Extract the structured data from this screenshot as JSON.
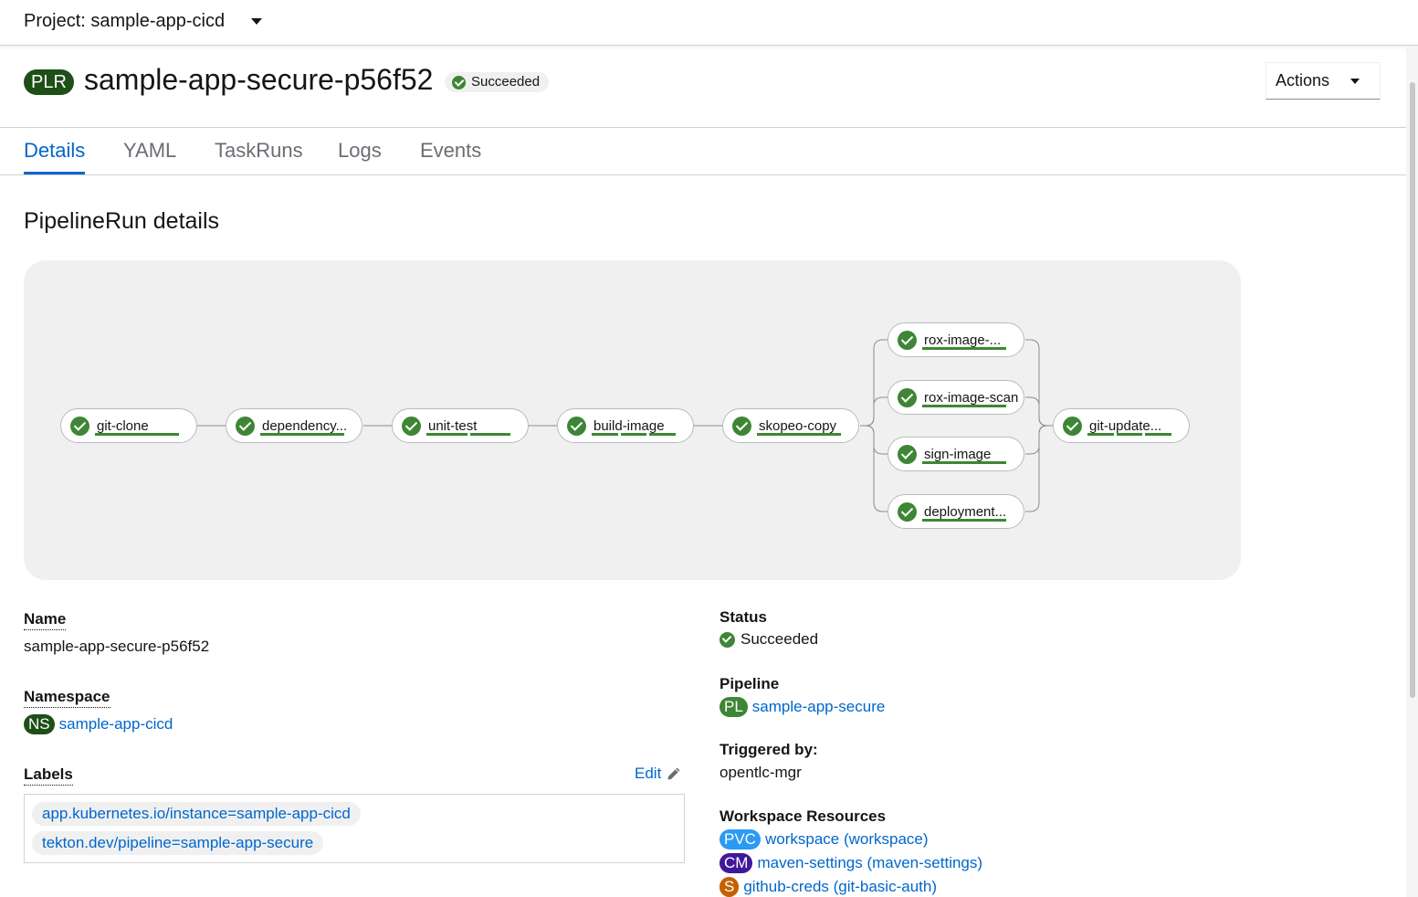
{
  "project_bar": {
    "label": "Project: sample-app-cicd"
  },
  "header": {
    "kind_badge": "PLR",
    "title": "sample-app-secure-p56f52",
    "status": "Succeeded",
    "actions_label": "Actions"
  },
  "tabs": [
    {
      "label": "Details"
    },
    {
      "label": "YAML"
    },
    {
      "label": "TaskRuns"
    },
    {
      "label": "Logs"
    },
    {
      "label": "Events"
    }
  ],
  "section_title": "PipelineRun details",
  "pipeline": {
    "tasks": [
      {
        "id": "git-clone",
        "label": "git-clone",
        "status": "Succeeded",
        "steps": 1
      },
      {
        "id": "dependency",
        "label": "dependency...",
        "status": "Succeeded",
        "steps": 1
      },
      {
        "id": "unit-test",
        "label": "unit-test",
        "status": "Succeeded",
        "steps": 2
      },
      {
        "id": "build-image",
        "label": "build-image",
        "status": "Succeeded",
        "steps": 3
      },
      {
        "id": "skopeo-copy",
        "label": "skopeo-copy",
        "status": "Succeeded",
        "steps": 1
      },
      {
        "id": "rox-image-check",
        "label": "rox-image-...",
        "status": "Succeeded",
        "steps": 1
      },
      {
        "id": "rox-image-scan",
        "label": "rox-image-scan",
        "status": "Succeeded",
        "steps": 1
      },
      {
        "id": "sign-image",
        "label": "sign-image",
        "status": "Succeeded",
        "steps": 1
      },
      {
        "id": "deployment",
        "label": "deployment...",
        "status": "Succeeded",
        "steps": 1
      },
      {
        "id": "git-update",
        "label": "git-update...",
        "status": "Succeeded",
        "steps": 3
      }
    ]
  },
  "details": {
    "name_label": "Name",
    "name_value": "sample-app-secure-p56f52",
    "namespace_label": "Namespace",
    "namespace_badge": "NS",
    "namespace_value": "sample-app-cicd",
    "labels_label": "Labels",
    "edit_label": "Edit",
    "labels": [
      "app.kubernetes.io/instance=sample-app-cicd",
      "tekton.dev/pipeline=sample-app-secure"
    ],
    "status_label": "Status",
    "status_value": "Succeeded",
    "pipeline_label": "Pipeline",
    "pipeline_badge": "PL",
    "pipeline_value": "sample-app-secure",
    "triggered_label": "Triggered by:",
    "triggered_value": "opentlc-mgr",
    "workspace_label": "Workspace Resources",
    "workspaces": [
      {
        "badge": "PVC",
        "value": "workspace (workspace)",
        "color": "#2b9af3"
      },
      {
        "badge": "CM",
        "value": "maven-settings (maven-settings)",
        "color": "#40199a"
      },
      {
        "badge": "S",
        "value": "github-creds (git-basic-auth)",
        "color": "#c46100"
      }
    ]
  },
  "colors": {
    "accent": "#0066cc",
    "success": "#3e8635",
    "plr_badge": "#1e4f18",
    "ns_badge": "#1e4f18",
    "pl_badge": "#3e8635"
  }
}
